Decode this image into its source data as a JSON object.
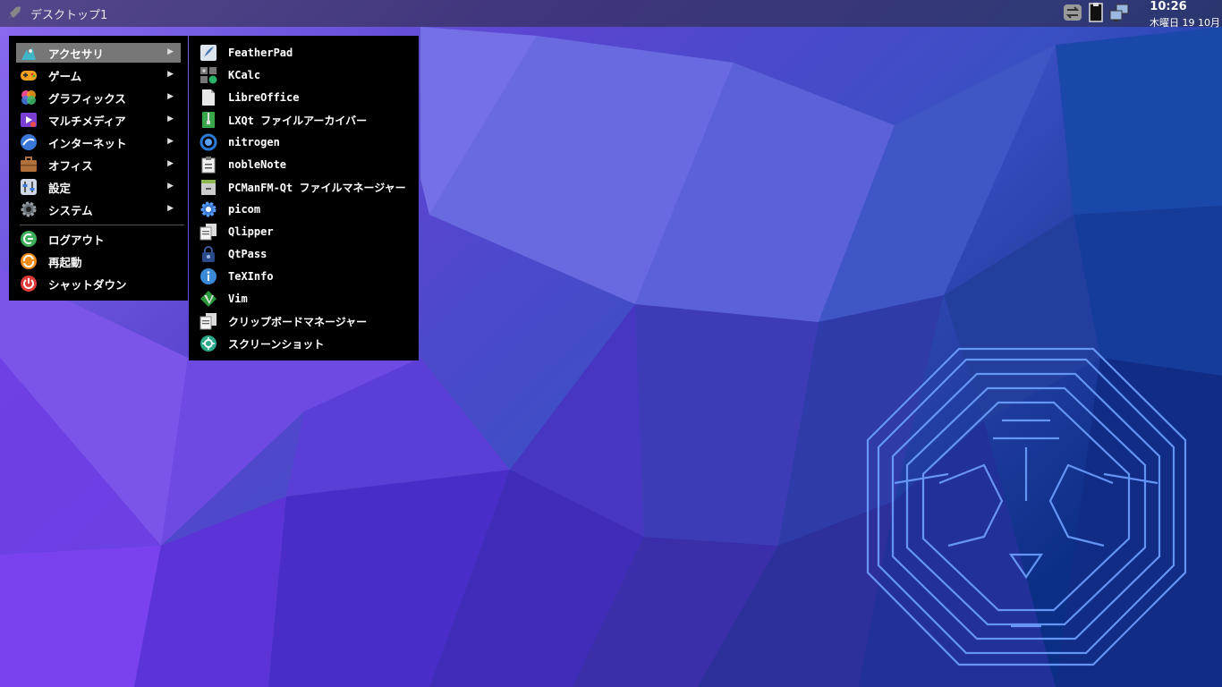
{
  "panel": {
    "desktop_label": "デスクトップ1",
    "clock_time": "10:26",
    "clock_date": "木曜日 19 10月"
  },
  "main_menu": {
    "items": [
      {
        "label": "アクセサリ",
        "icon": "accessories-icon"
      },
      {
        "label": "ゲーム",
        "icon": "gamepad-icon"
      },
      {
        "label": "グラフィックス",
        "icon": "graphics-icon"
      },
      {
        "label": "マルチメディア",
        "icon": "multimedia-icon"
      },
      {
        "label": "インターネット",
        "icon": "internet-icon"
      },
      {
        "label": "オフィス",
        "icon": "briefcase-icon"
      },
      {
        "label": "設定",
        "icon": "settings-icon"
      },
      {
        "label": "システム",
        "icon": "gear-icon"
      }
    ],
    "actions": [
      {
        "label": "ログアウト",
        "icon": "logout-icon"
      },
      {
        "label": "再起動",
        "icon": "reboot-icon"
      },
      {
        "label": "シャットダウン",
        "icon": "power-icon"
      }
    ]
  },
  "sub_menu": {
    "items": [
      {
        "label": "FeatherPad",
        "icon": "featherpad-icon"
      },
      {
        "label": "KCalc",
        "icon": "calculator-icon"
      },
      {
        "label": "LibreOffice",
        "icon": "document-icon"
      },
      {
        "label": "LXQt ファイルアーカイバー",
        "icon": "archive-icon"
      },
      {
        "label": "nitrogen",
        "icon": "nitrogen-icon"
      },
      {
        "label": "nobleNote",
        "icon": "clipboard-note-icon"
      },
      {
        "label": "PCManFM-Qt ファイルマネージャー",
        "icon": "file-manager-icon"
      },
      {
        "label": "picom",
        "icon": "picom-gear-icon"
      },
      {
        "label": "Qlipper",
        "icon": "clipboard-icon"
      },
      {
        "label": "QtPass",
        "icon": "lock-icon"
      },
      {
        "label": "TeXInfo",
        "icon": "info-icon"
      },
      {
        "label": "Vim",
        "icon": "vim-icon"
      },
      {
        "label": "クリップボードマネージャー",
        "icon": "clipboard-manager-icon"
      },
      {
        "label": "スクリーンショット",
        "icon": "screenshot-icon"
      }
    ]
  },
  "colors": {
    "panel": "#2a2a3a",
    "menu_bg": "#000000",
    "menu_highlight": "#777777",
    "desktop_purple": "#4a35c8",
    "desktop_blue": "#1a3a9a"
  }
}
